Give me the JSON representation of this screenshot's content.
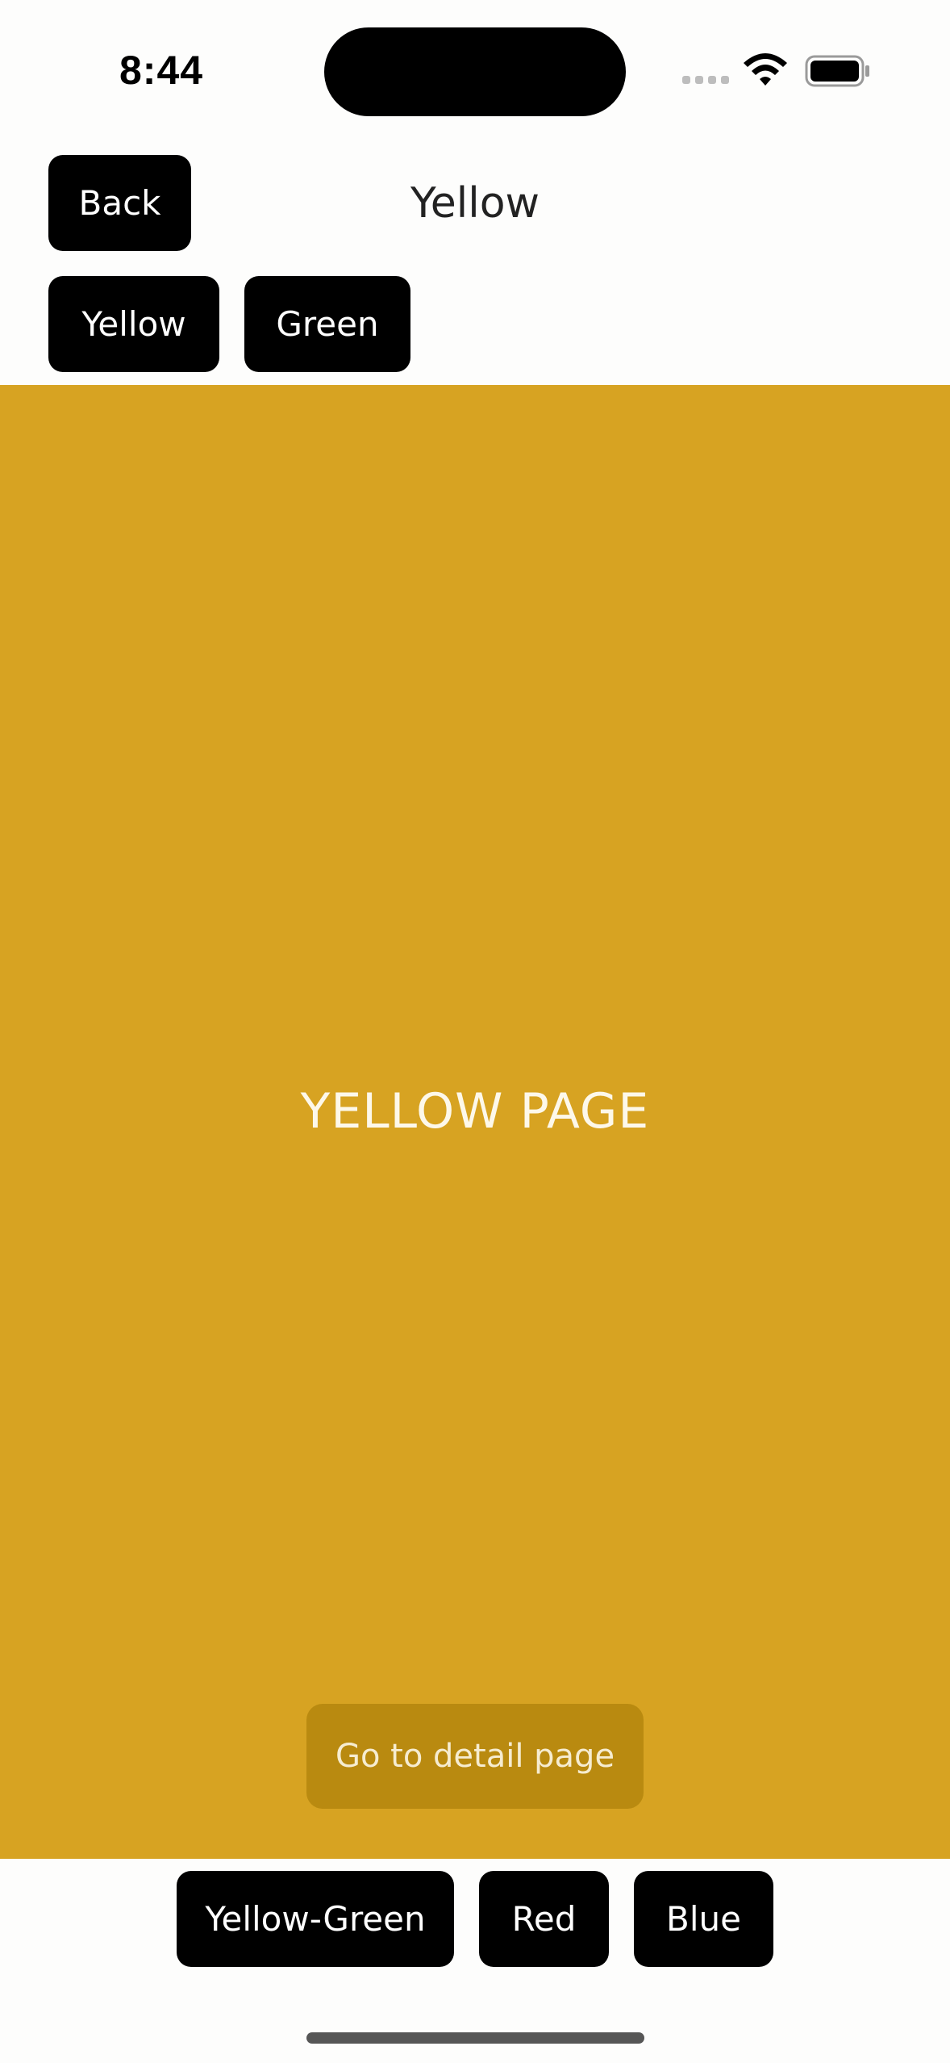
{
  "status_bar": {
    "time": "8:44",
    "icons": [
      "cellular-signal-icon",
      "wifi-icon",
      "battery-icon"
    ]
  },
  "header": {
    "back_label": "Back",
    "title": "Yellow"
  },
  "tabs": [
    {
      "label": "Yellow"
    },
    {
      "label": "Green"
    }
  ],
  "main": {
    "background_color": "#d7a322",
    "label": "YELLOW PAGE",
    "detail_button_label": "Go to detail page"
  },
  "bottom_nav": [
    {
      "label": "Yellow-Green"
    },
    {
      "label": "Red"
    },
    {
      "label": "Blue"
    }
  ]
}
